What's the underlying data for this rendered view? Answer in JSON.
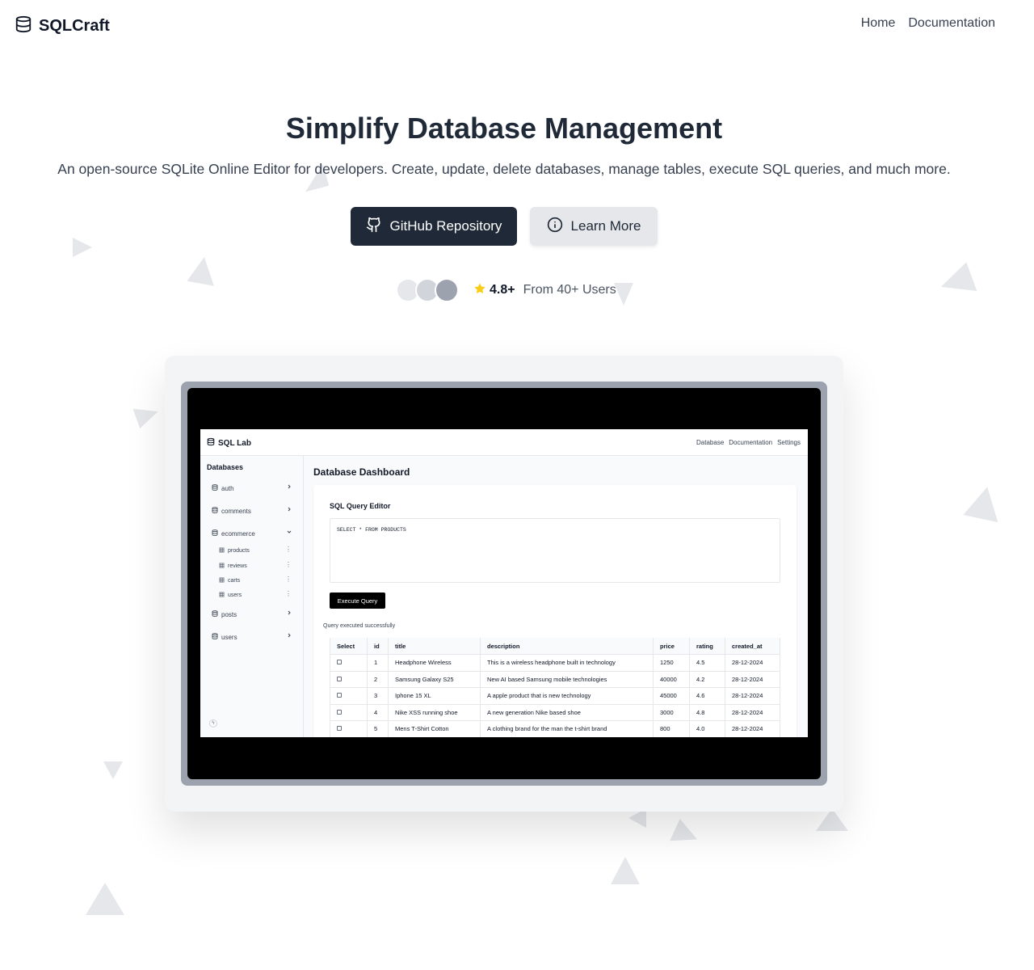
{
  "nav": {
    "brand": "SQLCraft",
    "links": [
      "Home",
      "Documentation"
    ]
  },
  "hero": {
    "title": "Simplify Database Management",
    "subtitle": "An open-source SQLite Online Editor for developers. Create, update, delete databases, manage tables, execute SQL queries, and much more.",
    "primary_button": "GitHub Repository",
    "secondary_button": "Learn More",
    "rating_value": "4.8+",
    "rating_text": "From 40+ Users"
  },
  "colors": {
    "primary": "#1f2937",
    "secondary": "#e5e7eb",
    "star": "#facc15"
  },
  "preview": {
    "app_brand": "SQL Lab",
    "app_links": [
      "Database",
      "Documentation",
      "Settings"
    ],
    "sidebar": {
      "heading": "Databases",
      "items": [
        {
          "label": "auth",
          "expanded": false
        },
        {
          "label": "comments",
          "expanded": false
        },
        {
          "label": "ecommerce",
          "expanded": true,
          "tables": [
            "products",
            "reviews",
            "carts",
            "users"
          ]
        },
        {
          "label": "posts",
          "expanded": false
        },
        {
          "label": "users",
          "expanded": false
        }
      ]
    },
    "main_title": "Database Dashboard",
    "editor_title": "SQL Query Editor",
    "query": "SELECT * FROM PRODUCTS",
    "execute_button": "Execute Query",
    "status": "Query executed successfully",
    "table": {
      "columns": [
        "Select",
        "id",
        "title",
        "description",
        "price",
        "rating",
        "created_at"
      ],
      "rows": [
        [
          "1",
          "Headphone Wireless",
          "This is a wireless headphone built in technology",
          "1250",
          "4.5",
          "28-12-2024"
        ],
        [
          "2",
          "Samsung Galaxy S25",
          "New AI based Samsung mobile technologies",
          "40000",
          "4.2",
          "28-12-2024"
        ],
        [
          "3",
          "Iphone 15 XL",
          "A apple product that is new technology",
          "45000",
          "4.6",
          "28-12-2024"
        ],
        [
          "4",
          "Nike XSS running shoe",
          "A new generation Nike based shoe",
          "3000",
          "4.8",
          "28-12-2024"
        ],
        [
          "5",
          "Mens T-Shirt Cotton",
          "A clothing brand for the man the t-shirt brand",
          "800",
          "4.0",
          "28-12-2024"
        ]
      ]
    }
  }
}
